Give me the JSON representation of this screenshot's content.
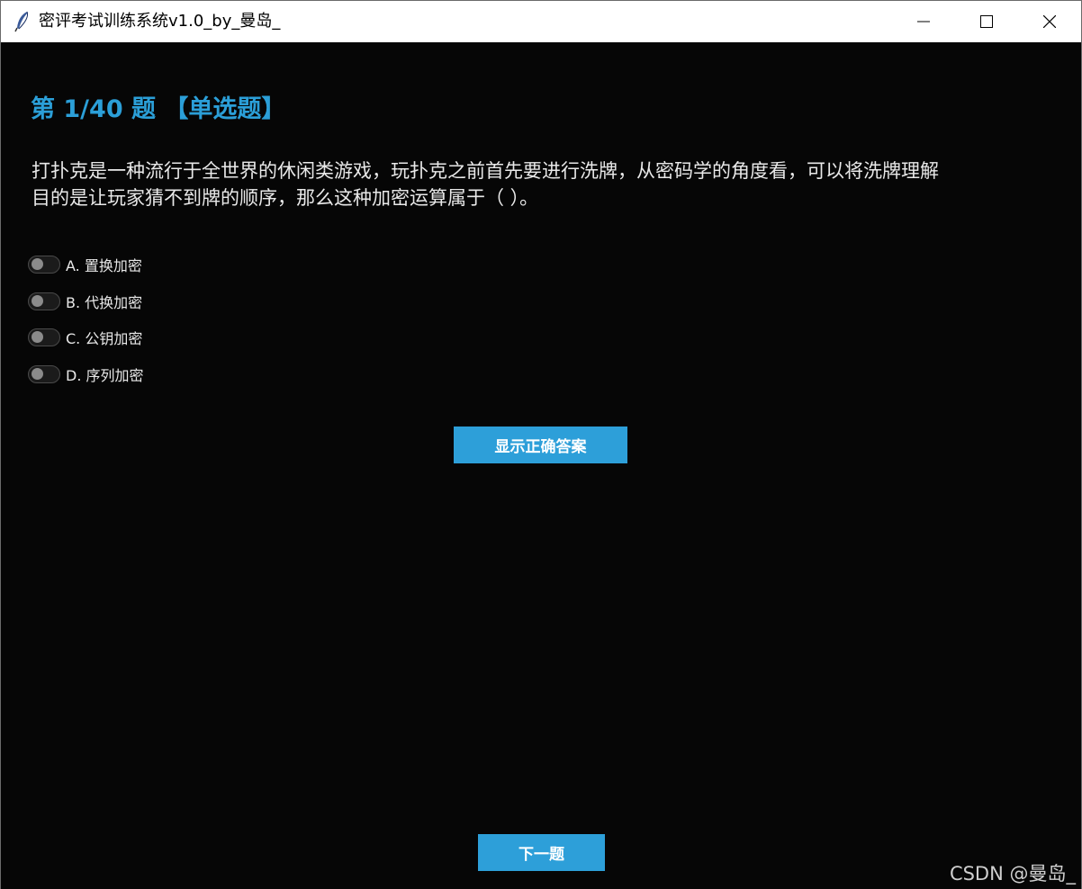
{
  "window": {
    "title": "密评考试训练系统v1.0_by_曼岛_",
    "app_icon": "feather-icon",
    "controls": [
      "minimize-icon",
      "maximize-icon",
      "close-icon"
    ]
  },
  "question": {
    "header": "第 1/40 题 【单选题】",
    "text_line1": "打扑克是一种流行于全世界的休闲类游戏，玩扑克之前首先要进行洗牌，从密码学的角度看，可以将洗牌理解",
    "text_line2": "目的是让玩家猜不到牌的顺序，那么这种加密运算属于（ ）。"
  },
  "options": [
    {
      "label": "A. 置换加密",
      "selected": false
    },
    {
      "label": "B. 代换加密",
      "selected": false
    },
    {
      "label": "C. 公钥加密",
      "selected": false
    },
    {
      "label": "D. 序列加密",
      "selected": false
    }
  ],
  "buttons": {
    "show_answer": "显示正确答案",
    "next": "下一题"
  },
  "watermark": "CSDN @曼岛_",
  "colors": {
    "accent": "#2b9fd8",
    "background": "#060606",
    "text": "#e9e9e9"
  }
}
